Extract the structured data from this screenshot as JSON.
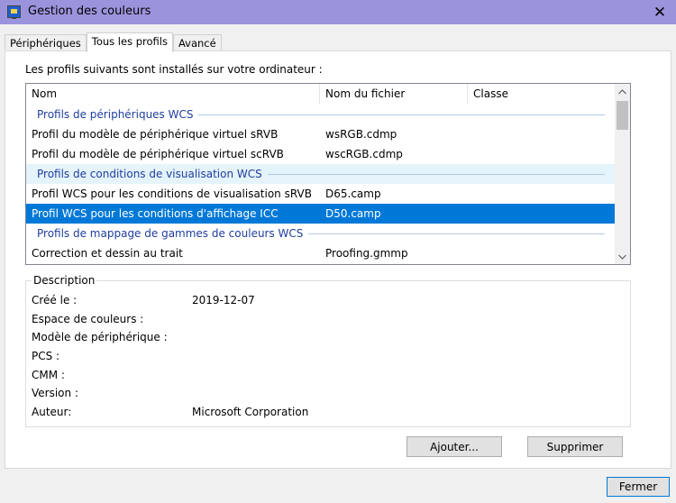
{
  "window": {
    "title": "Gestion des couleurs",
    "close_glyph": "✕"
  },
  "tabs": [
    {
      "label": "Périphériques",
      "active": false
    },
    {
      "label": "Tous les profils",
      "active": true
    },
    {
      "label": "Avancé",
      "active": false
    }
  ],
  "intro": "Les profils suivants sont installés sur votre ordinateur :",
  "list": {
    "columns": {
      "nom": "Nom",
      "fichier": "Nom du fichier",
      "classe": "Classe"
    },
    "group1": "Profils de périphériques WCS",
    "row1": {
      "nom": "Profil du modèle de périphérique virtuel sRVB",
      "fichier": "wsRGB.cdmp"
    },
    "row2": {
      "nom": "Profil du modèle de périphérique virtuel scRVB",
      "fichier": "wscRGB.cdmp"
    },
    "group2": "Profils de conditions de visualisation WCS",
    "row3": {
      "nom": "Profil WCS pour les conditions de visualisation sRVB",
      "fichier": "D65.camp"
    },
    "row4": {
      "nom": "Profil WCS pour les conditions d'affichage ICC",
      "fichier": "D50.camp"
    },
    "group3": "Profils de mappage de gammes de couleurs WCS",
    "row5": {
      "nom": "Correction et dessin au trait",
      "fichier": "Proofing.gmmp"
    }
  },
  "description": {
    "legend": "Description",
    "cree_label": "Créé le :",
    "cree_value": "2019-12-07",
    "espace_label": "Espace de couleurs :",
    "modele_label": "Modèle de périphérique :",
    "pcs_label": "PCS :",
    "cmm_label": "CMM :",
    "version_label": "Version :",
    "auteur_label": "Auteur:",
    "auteur_value": "Microsoft Corporation"
  },
  "buttons": {
    "add": "Ajouter...",
    "delete": "Supprimer",
    "close": "Fermer"
  },
  "colors": {
    "titlebar": "#9b94dd",
    "selection": "#0078d7",
    "group_text": "#1e3e9e"
  }
}
